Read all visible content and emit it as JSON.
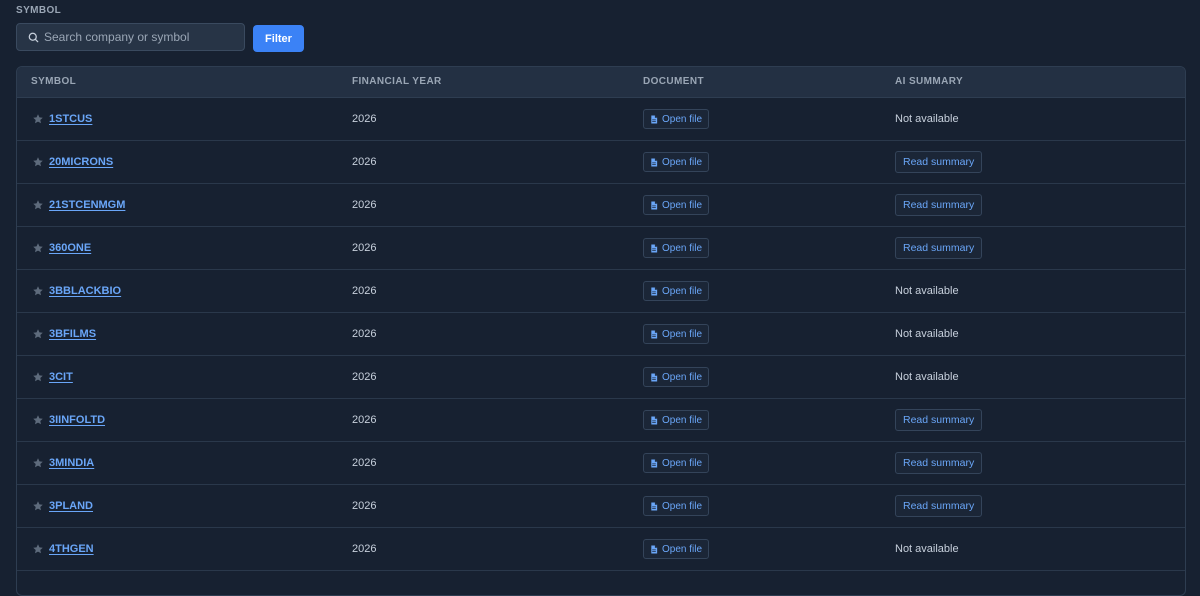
{
  "filter": {
    "label": "SYMBOL",
    "placeholder": "Search company or symbol",
    "value": "",
    "button_label": "Filter"
  },
  "table": {
    "headers": [
      "SYMBOL",
      "FINANCIAL YEAR",
      "DOCUMENT",
      "AI SUMMARY"
    ],
    "open_file_label": "Open file",
    "read_summary_label": "Read summary",
    "not_available_label": "Not available",
    "rows": [
      {
        "symbol": "1STCUS",
        "year": "2026",
        "summary": false
      },
      {
        "symbol": "20MICRONS",
        "year": "2026",
        "summary": true
      },
      {
        "symbol": "21STCENMGM",
        "year": "2026",
        "summary": true
      },
      {
        "symbol": "360ONE",
        "year": "2026",
        "summary": true
      },
      {
        "symbol": "3BBLACKBIO",
        "year": "2026",
        "summary": false
      },
      {
        "symbol": "3BFILMS",
        "year": "2026",
        "summary": false
      },
      {
        "symbol": "3CIT",
        "year": "2026",
        "summary": false
      },
      {
        "symbol": "3IINFOLTD",
        "year": "2026",
        "summary": true
      },
      {
        "symbol": "3MINDIA",
        "year": "2026",
        "summary": true
      },
      {
        "symbol": "3PLAND",
        "year": "2026",
        "summary": true
      },
      {
        "symbol": "4THGEN",
        "year": "2026",
        "summary": false
      }
    ]
  },
  "icons": {
    "star": "star-icon",
    "search": "search-icon",
    "file": "file-icon"
  },
  "colors": {
    "background": "#172131",
    "header": "#233043",
    "accent": "#3b82f6",
    "link": "#6aa6f8",
    "star": "#5e6b7c"
  }
}
